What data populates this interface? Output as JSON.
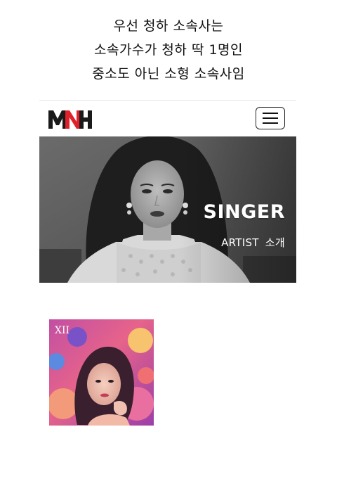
{
  "caption": {
    "lines": [
      "우선 청하 소속사는",
      "소속가수가 청하 딱 1명인",
      "중소도 아닌 소형 소속사임"
    ]
  },
  "navbar": {
    "logo_text": "MNH",
    "menu_icon": "hamburger-icon"
  },
  "hero": {
    "title": "SINGER",
    "subtitle": "ARTIST  소개"
  },
  "album": {
    "cover_text": "XII"
  }
}
